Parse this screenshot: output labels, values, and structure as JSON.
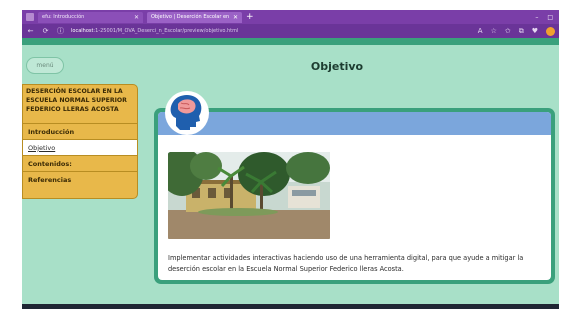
{
  "browser": {
    "tabs": [
      {
        "label": "efu: Introducción",
        "active": false
      },
      {
        "label": "Objetivo | Deserción Escolar en",
        "active": true
      }
    ],
    "url_host": "localhost",
    "url_path": ":1-25001/M_OVA_Deserci_n_Escolar/preview/objetivo.html",
    "icons": {
      "back": "back-arrow-icon",
      "refresh": "refresh-icon",
      "info": "info-icon"
    }
  },
  "page": {
    "menu_label": "menú",
    "title": "Objetivo",
    "sidebar": {
      "title": "DESERCIÓN ESCOLAR EN LA ESCUELA NORMAL SUPERIOR FEDERICO LLERAS ACOSTA",
      "items": [
        {
          "label": "Introducción",
          "active": false
        },
        {
          "label": "Objetivo",
          "active": true
        },
        {
          "label": "Contenidos:",
          "active": false
        },
        {
          "label": "Referencias",
          "active": false
        }
      ]
    },
    "objective_text": "Implementar actividades interactivas haciendo uso de una herramienta digital, para que ayude a mitigar la deserción escolar en la Escuela Normal Superior Federico lleras Acosta."
  },
  "colors": {
    "page_bg": "#a8e0c8",
    "accent_green": "#3aa07c",
    "sidebar_gold": "#e8b84a",
    "card_header_blue": "#7ba6dc",
    "browser_purple": "#7a3ea8"
  }
}
